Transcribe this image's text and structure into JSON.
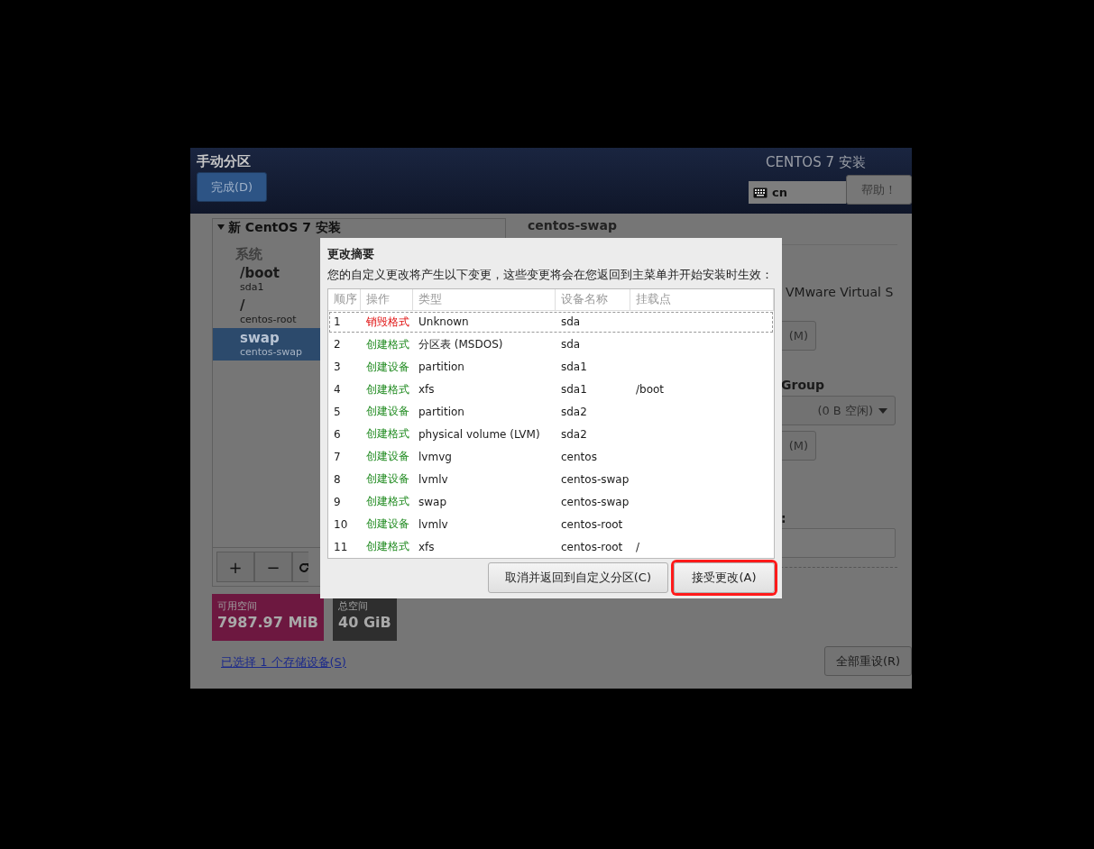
{
  "header": {
    "title": "手动分区",
    "done_button": "完成(D)",
    "product": "CENTOS 7 安装",
    "keyboard": "cn",
    "help_button": "帮助！"
  },
  "tree": {
    "root": "新 CentOS 7 安装",
    "expanded": true,
    "group": "系统",
    "items": [
      {
        "mount": "/boot",
        "device": "sda1",
        "selected": false
      },
      {
        "mount": "/",
        "device": "centos-root",
        "selected": false
      },
      {
        "mount": "swap",
        "device": "centos-swap",
        "selected": true
      }
    ]
  },
  "tree_buttons": [
    "+",
    "−"
  ],
  "space": {
    "available_label": "可用空间",
    "available": "7987.97 MiB",
    "total_label": "总空间",
    "total": "40 GiB"
  },
  "storage_link": "已选择 1 个存储设备(S)",
  "details": {
    "heading": "centos-swap",
    "device_text": "VMware Virtual S",
    "modify_button_1": "(M)",
    "group_label": "Group",
    "group_dropdown": "(0 B 空闲)",
    "modify_button_2": "(M)",
    "field_label": ":"
  },
  "reset_button": "全部重设(R)",
  "dialog": {
    "title": "更改摘要",
    "message": "您的自定义更改将产生以下变更，这些变更将会在您返回到主菜单并开始安装时生效：",
    "columns": [
      "顺序",
      "操作",
      "类型",
      "设备名称",
      "挂载点"
    ],
    "rows": [
      {
        "order": "1",
        "action": "销毁格式",
        "kind": "destroy",
        "type": "Unknown",
        "device": "sda",
        "mount": "",
        "focused": true
      },
      {
        "order": "2",
        "action": "创建格式",
        "kind": "create",
        "type": "分区表 (MSDOS)",
        "device": "sda",
        "mount": "",
        "focused": false
      },
      {
        "order": "3",
        "action": "创建设备",
        "kind": "create",
        "type": "partition",
        "device": "sda1",
        "mount": "",
        "focused": false
      },
      {
        "order": "4",
        "action": "创建格式",
        "kind": "create",
        "type": "xfs",
        "device": "sda1",
        "mount": "/boot",
        "focused": false
      },
      {
        "order": "5",
        "action": "创建设备",
        "kind": "create",
        "type": "partition",
        "device": "sda2",
        "mount": "",
        "focused": false
      },
      {
        "order": "6",
        "action": "创建格式",
        "kind": "create",
        "type": "physical volume (LVM)",
        "device": "sda2",
        "mount": "",
        "focused": false
      },
      {
        "order": "7",
        "action": "创建设备",
        "kind": "create",
        "type": "lvmvg",
        "device": "centos",
        "mount": "",
        "focused": false
      },
      {
        "order": "8",
        "action": "创建设备",
        "kind": "create",
        "type": "lvmlv",
        "device": "centos-swap",
        "mount": "",
        "focused": false
      },
      {
        "order": "9",
        "action": "创建格式",
        "kind": "create",
        "type": "swap",
        "device": "centos-swap",
        "mount": "",
        "focused": false
      },
      {
        "order": "10",
        "action": "创建设备",
        "kind": "create",
        "type": "lvmlv",
        "device": "centos-root",
        "mount": "",
        "focused": false
      },
      {
        "order": "11",
        "action": "创建格式",
        "kind": "create",
        "type": "xfs",
        "device": "centos-root",
        "mount": "/",
        "focused": false
      }
    ],
    "cancel_button": "取消并返回到自定义分区(C)",
    "accept_button": {
      "label": "接受更改(A)",
      "highlighted": true
    }
  }
}
